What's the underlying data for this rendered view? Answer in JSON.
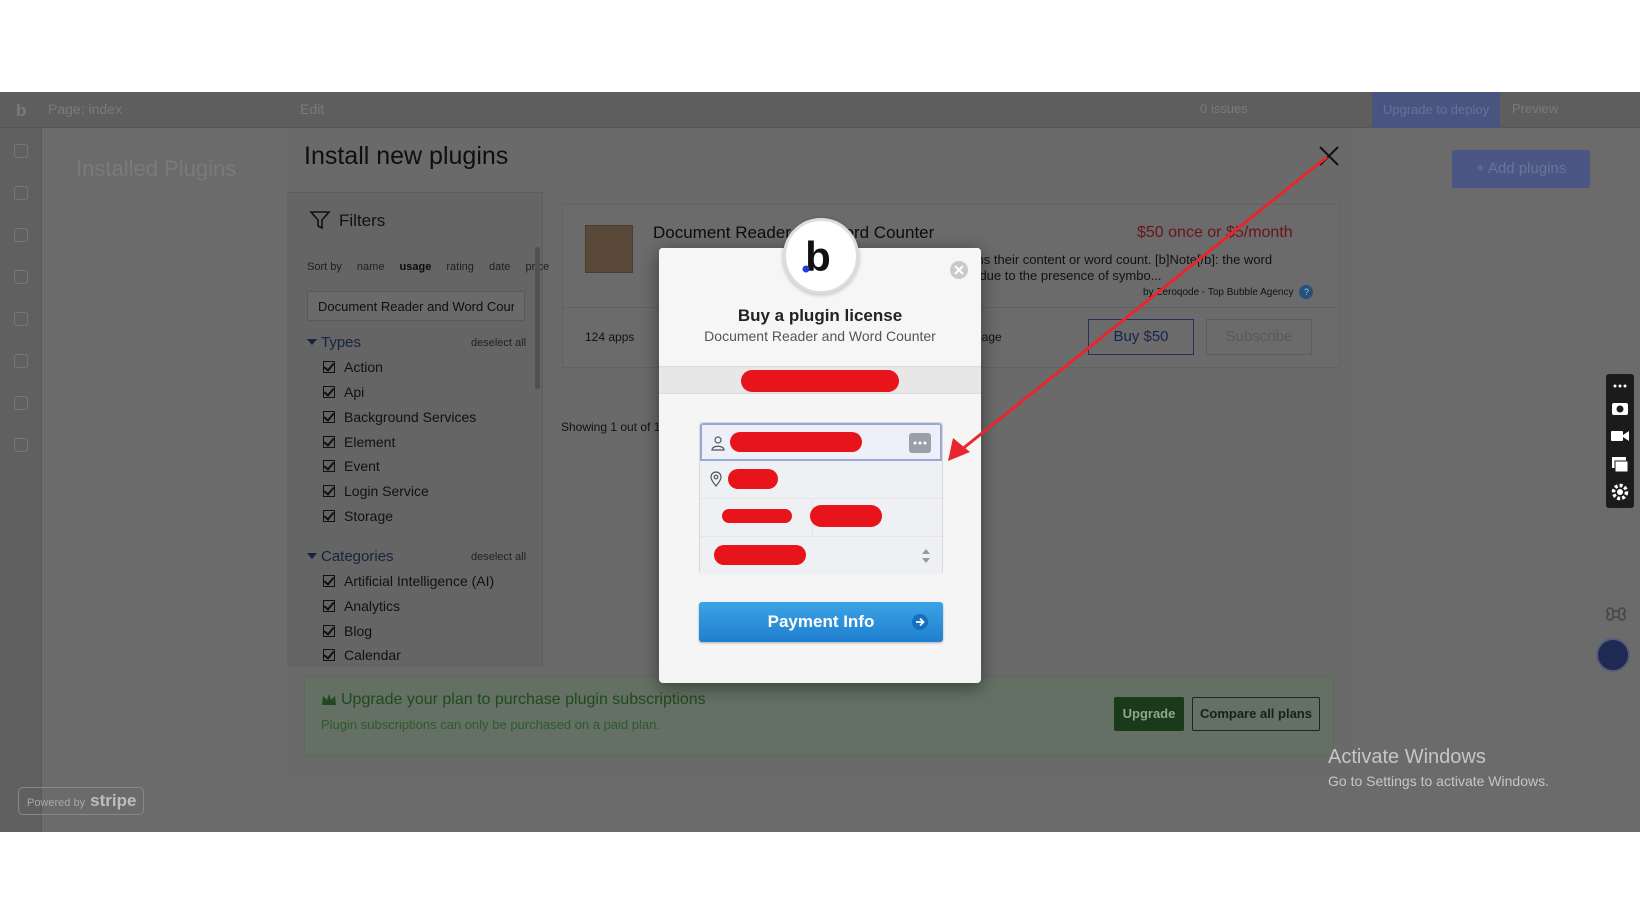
{
  "editor": {
    "page_label": "Page: index",
    "edit_label": "Edit",
    "issues": "0 issues",
    "upgrade_deploy": "Upgrade to deploy",
    "preview": "Preview",
    "installed_title": "Installed Plugins",
    "add_plugins": "+ Add plugins"
  },
  "plugin_modal": {
    "title": "Install new plugins",
    "filters_label": "Filters",
    "sort_by_label": "Sort by",
    "sort_options": [
      "name",
      "usage",
      "rating",
      "date",
      "price"
    ],
    "sort_active": "usage",
    "search_value": "Document Reader and Word Coun",
    "types_label": "Types",
    "types_deselect": "deselect all",
    "types": [
      "Action",
      "Api",
      "Background Services",
      "Element",
      "Event",
      "Login Service",
      "Storage"
    ],
    "categories_label": "Categories",
    "categories_deselect": "deselect all",
    "categories": [
      "Artificial Intelligence (AI)",
      "Analytics",
      "Blog",
      "Calendar"
    ],
    "card": {
      "name": "Document Reader and Word Counter",
      "price": "$50 once or $5/month",
      "desc_line1": "urns their content or word count. [b]Note[/b]: the word",
      "desc_line2": "rs due to the presence of symbo...",
      "author": "by Zeroqode - Top Bubble Agency",
      "apps_count": "124 apps",
      "page_text": "n page",
      "buy_label": "Buy $50",
      "subscribe_label": "Subscribe"
    },
    "showing": "Showing 1 out of 1",
    "upgrade": {
      "title": "Upgrade your plan to purchase plugin subscriptions",
      "subtitle": "Plugin subscriptions can only be purchased on a paid plan.",
      "upgrade_label": "Upgrade",
      "compare_label": "Compare all plans"
    }
  },
  "checkout": {
    "logo_letter": "b",
    "title": "Buy a plugin license",
    "subtitle": "Document Reader and Word Counter",
    "payment_label": "Payment Info"
  },
  "stripe_badge": {
    "powered": "Powered by",
    "brand": "stripe"
  },
  "windows": {
    "title": "Activate Windows",
    "subtitle": "Go to Settings to activate Windows."
  },
  "colors": {
    "redaction": "#e8141c",
    "annotation_arrow": "#e8262d",
    "checkout_button": "#2b8fdb"
  }
}
